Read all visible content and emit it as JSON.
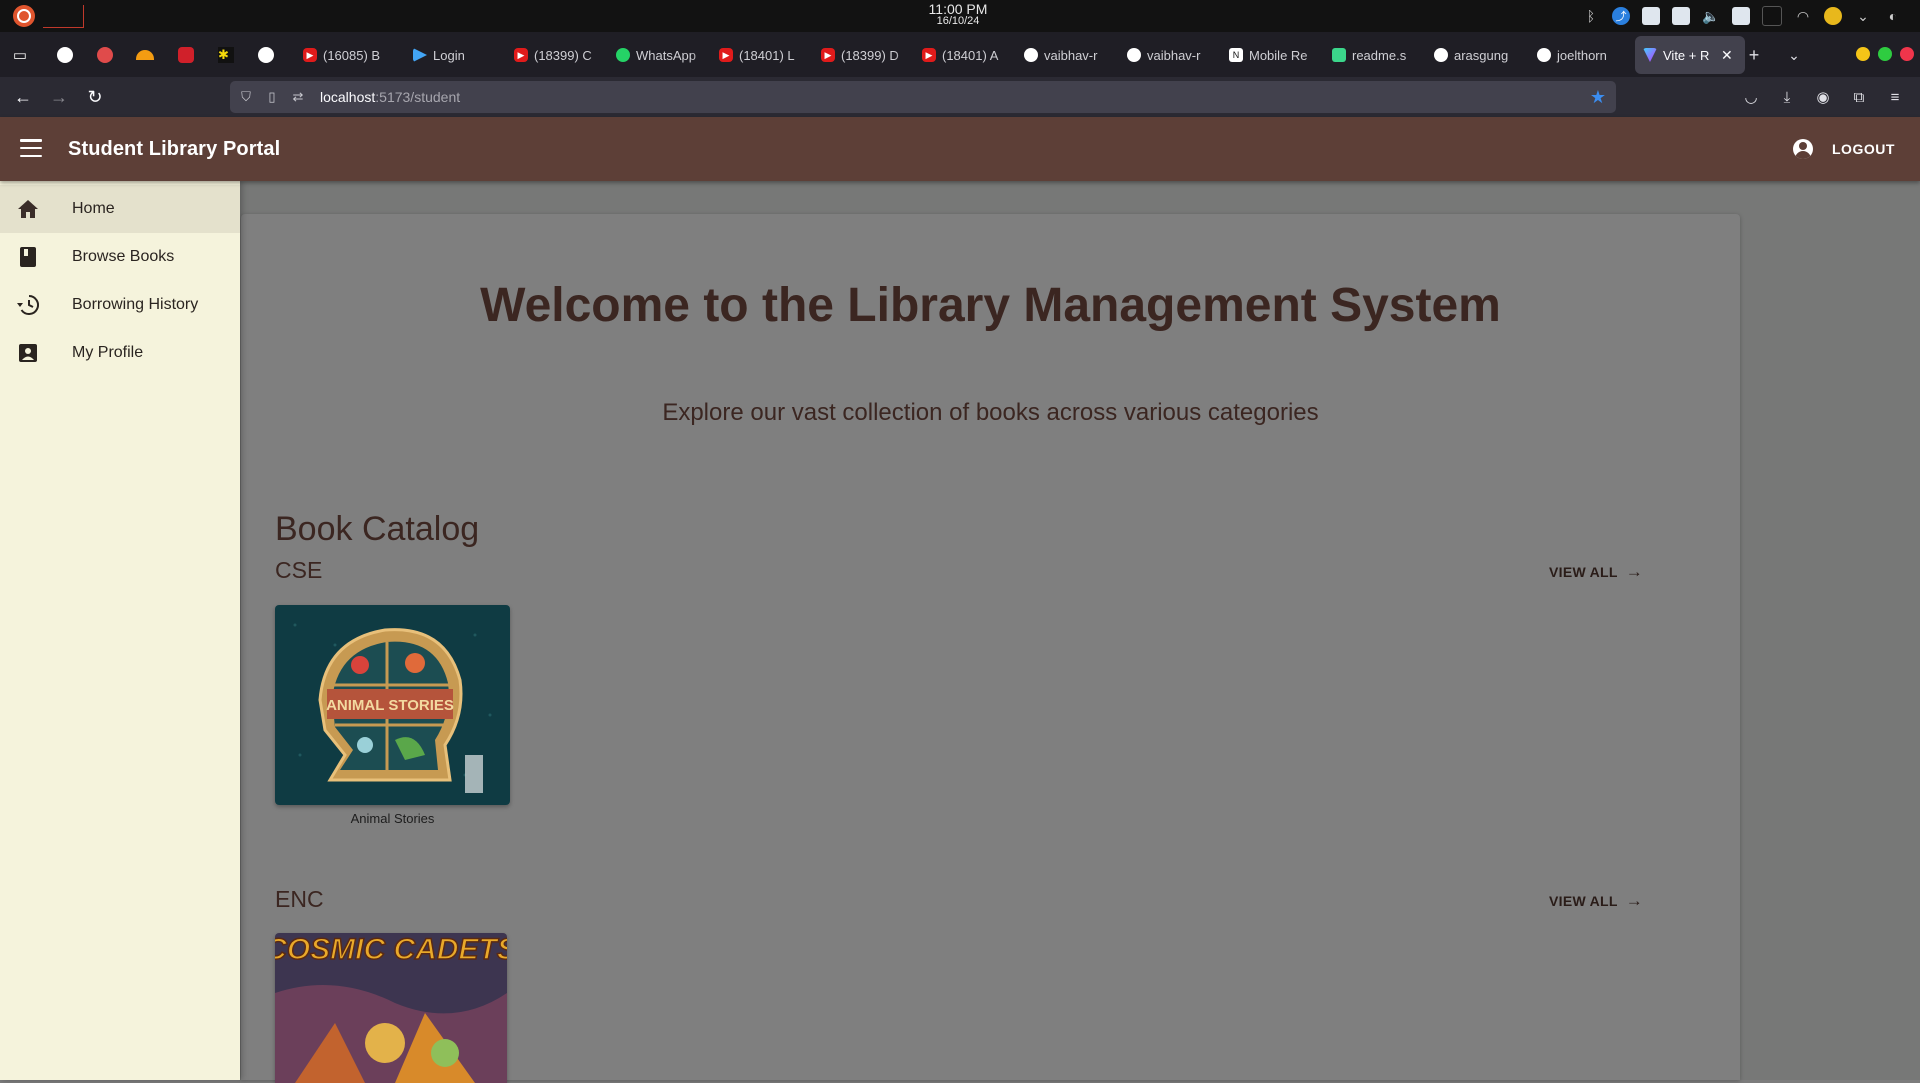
{
  "os": {
    "time": "11:00 PM",
    "date": "16/10/24"
  },
  "browser": {
    "tabs": [
      {
        "label": "(16085) B",
        "icon": "youtube-icon"
      },
      {
        "label": "Login",
        "icon": "login-icon"
      },
      {
        "label": "(18399) C",
        "icon": "youtube-icon"
      },
      {
        "label": "WhatsApp",
        "icon": "whatsapp-icon"
      },
      {
        "label": "(18401) L",
        "icon": "youtube-icon"
      },
      {
        "label": "(18399) D",
        "icon": "youtube-icon"
      },
      {
        "label": "(18401) A",
        "icon": "youtube-icon"
      },
      {
        "label": "vaibhav-r",
        "icon": "github-icon"
      },
      {
        "label": "vaibhav-r",
        "icon": "github-icon"
      },
      {
        "label": "Mobile Re",
        "icon": "notion-icon"
      },
      {
        "label": "readme.s",
        "icon": "readme-icon"
      },
      {
        "label": "arasgung",
        "icon": "github-icon"
      },
      {
        "label": "joelthorn",
        "icon": "github-icon"
      }
    ],
    "active_tab": {
      "label": "Vite + R",
      "icon": "vite-icon"
    },
    "url_host": "localhost",
    "url_path": ":5173/student"
  },
  "app": {
    "title": "Student Library Portal",
    "logout_label": "LOGOUT"
  },
  "drawer": {
    "items": [
      {
        "label": "Home",
        "icon": "home-icon",
        "active": true
      },
      {
        "label": "Browse Books",
        "icon": "book-icon",
        "active": false
      },
      {
        "label": "Borrowing History",
        "icon": "history-icon",
        "active": false
      },
      {
        "label": "My Profile",
        "icon": "profile-icon",
        "active": false
      }
    ]
  },
  "main": {
    "welcome": "Welcome to the Library Management System",
    "subtitle": "Explore our vast collection of books across various categories",
    "catalog_title": "Book Catalog",
    "view_all_label": "VIEW ALL",
    "categories": [
      {
        "name": "CSE",
        "books": [
          {
            "title": "Animal Stories",
            "cover_text": "ANIMAL STORIES"
          }
        ]
      },
      {
        "name": "ENC",
        "books": [
          {
            "title": "",
            "cover_text": "COSMIC CADETS"
          }
        ]
      }
    ]
  },
  "colors": {
    "app_bar": "#5d3f37",
    "drawer": "#f5f3dc",
    "heading_text": "#3b2621",
    "url_star": "#3b8df0"
  }
}
